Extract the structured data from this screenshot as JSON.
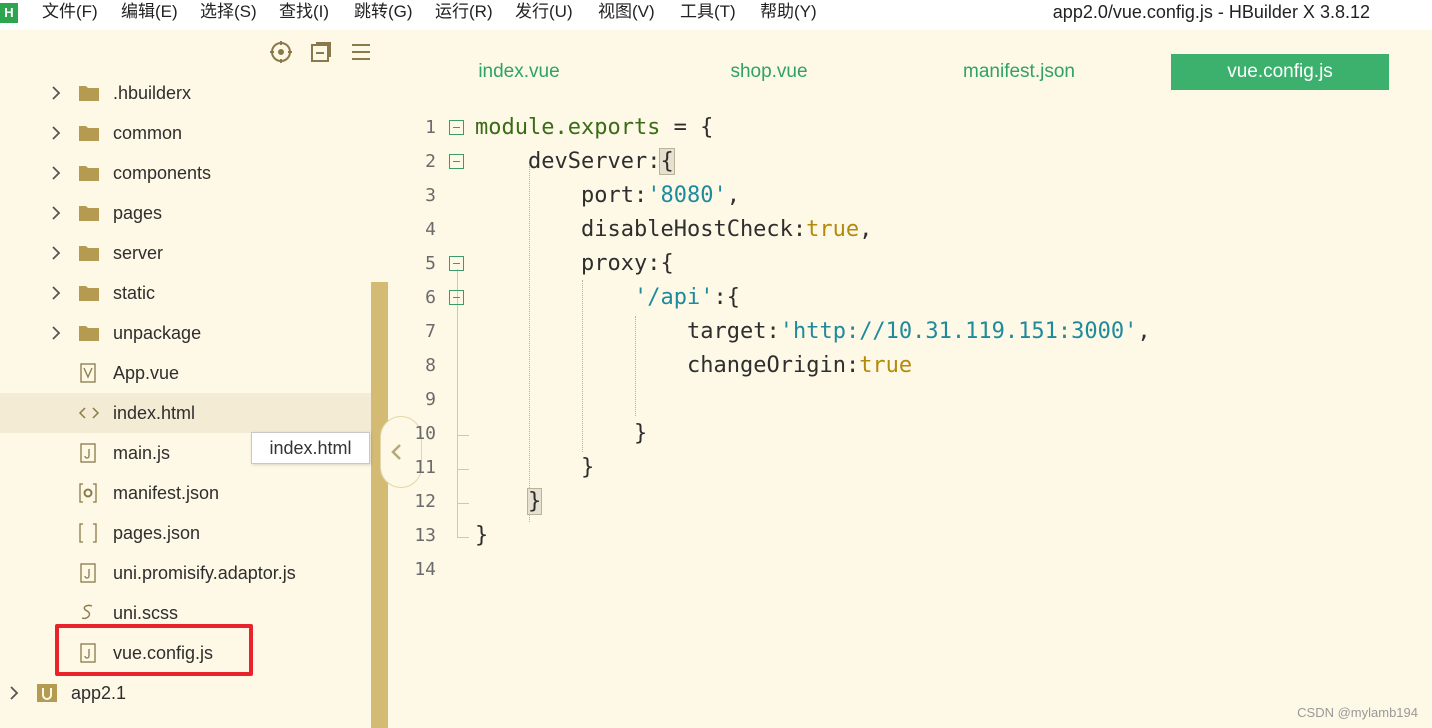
{
  "app": {
    "logo": "H",
    "window_title": "app2.0/vue.config.js - HBuilder X 3.8.12"
  },
  "menu": [
    "文件(F)",
    "编辑(E)",
    "选择(S)",
    "查找(I)",
    "跳转(G)",
    "运行(R)",
    "发行(U)",
    "视图(V)",
    "工具(T)",
    "帮助(Y)"
  ],
  "sidebar": {
    "tools": [
      "locate-icon",
      "collapse-all-icon",
      "menu-icon"
    ],
    "items": [
      {
        "label": ".hbuilderx",
        "type": "folder"
      },
      {
        "label": "common",
        "type": "folder"
      },
      {
        "label": "components",
        "type": "folder"
      },
      {
        "label": "pages",
        "type": "folder"
      },
      {
        "label": "server",
        "type": "folder"
      },
      {
        "label": "static",
        "type": "folder"
      },
      {
        "label": "unpackage",
        "type": "folder"
      },
      {
        "label": "App.vue",
        "type": "vue-file"
      },
      {
        "label": "index.html",
        "type": "html-file"
      },
      {
        "label": "main.js",
        "type": "js-file"
      },
      {
        "label": "manifest.json",
        "type": "json-settings-file"
      },
      {
        "label": "pages.json",
        "type": "json-file"
      },
      {
        "label": "uni.promisify.adaptor.js",
        "type": "js-file"
      },
      {
        "label": "uni.scss",
        "type": "scss-file"
      },
      {
        "label": "vue.config.js",
        "type": "js-file"
      }
    ],
    "project": {
      "label": "app2.1"
    },
    "tooltip": "index.html"
  },
  "tabs": [
    {
      "label": "index.vue",
      "active": false
    },
    {
      "label": "shop.vue",
      "active": false
    },
    {
      "label": "manifest.json",
      "active": false
    },
    {
      "label": "vue.config.js",
      "active": true
    }
  ],
  "editor": {
    "line_numbers": [
      "1",
      "2",
      "3",
      "4",
      "5",
      "6",
      "7",
      "8",
      "9",
      "10",
      "11",
      "12",
      "13",
      "14"
    ],
    "tokens": {
      "l1_a": "module.exports",
      "l1_b": " = {",
      "l2_a": "devServer:",
      "l2_b": "{",
      "l3_a": "port:",
      "l3_b": "'8080'",
      "l3_c": ",",
      "l4_a": "disableHostCheck:",
      "l4_b": "true",
      "l4_c": ",",
      "l5": "proxy:{",
      "l6_a": "'/api'",
      "l6_b": ":{",
      "l7_a": "target:",
      "l7_b": "'http://10.31.119.151:3000'",
      "l7_c": ",",
      "l8_a": "changeOrigin:",
      "l8_b": "true",
      "l10": "}",
      "l11": "}",
      "l12": "}",
      "l13": "}"
    }
  },
  "watermark": "CSDN @mylamb194",
  "colors": {
    "tab_active": "#3bb16d",
    "tab_text": "#2ea26a",
    "splitter": "#d4bb73",
    "highlight": "#e8232b",
    "background": "#fef8e6"
  }
}
